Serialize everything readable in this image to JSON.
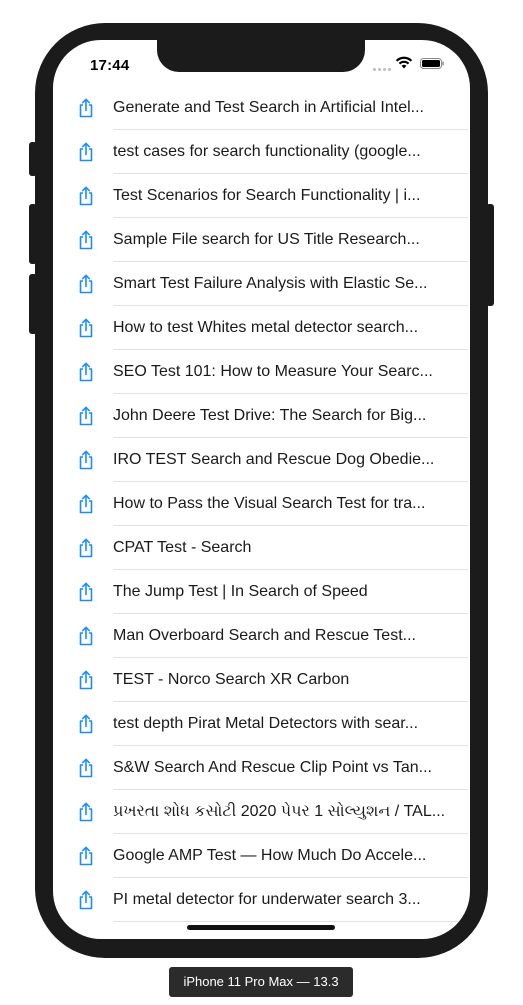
{
  "status_bar": {
    "time": "17:44"
  },
  "results": [
    "Generate and Test Search in Artificial Intel...",
    "test cases for search functionality (google...",
    "Test Scenarios for Search Functionality | i...",
    "Sample File search for US Title Research...",
    "Smart Test Failure Analysis with Elastic Se...",
    "How to test Whites metal detector search...",
    "SEO Test 101: How to Measure Your Searc...",
    "John Deere Test Drive: The Search for Big...",
    "IRO TEST Search and Rescue Dog Obedie...",
    "How to Pass the Visual Search Test for tra...",
    "CPAT Test - Search",
    "The Jump Test | In Search of Speed",
    "Man Overboard Search and Rescue Test...",
    "TEST - Norco Search XR Carbon",
    "test depth Pirat Metal Detectors with sear...",
    "S&W Search And Rescue Clip Point vs Tan...",
    "પ્રખરતા શોધ કસોટી 2020 પેપર 1 સોલ્યુશન / TAL...",
    "Google AMP Test — How Much Do Accele...",
    "PI metal detector for underwater search 3..."
  ],
  "icons": {
    "row_icon": "share-icon",
    "accent_color": "#1a8cff"
  },
  "device_label": "iPhone 11 Pro Max — 13.3"
}
